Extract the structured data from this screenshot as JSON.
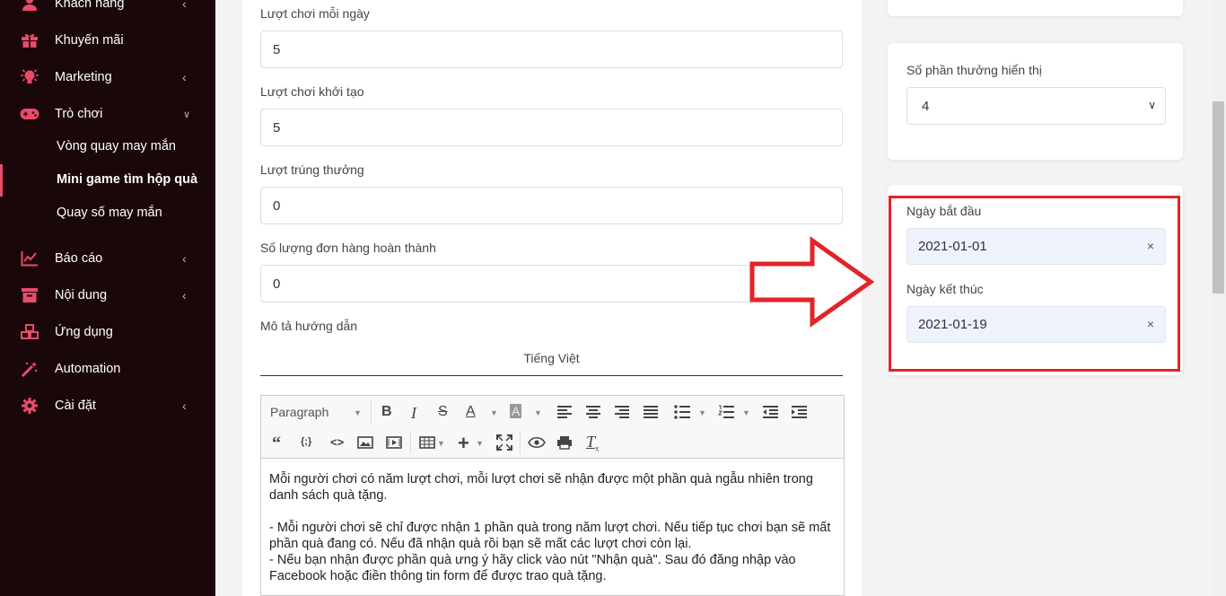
{
  "sidebar": {
    "items": [
      {
        "label": "Khách hàng",
        "icon": "user-icon"
      },
      {
        "label": "Khuyến mãi",
        "icon": "gift-icon"
      },
      {
        "label": "Marketing",
        "icon": "lightbulb-icon"
      },
      {
        "label": "Trò chơi",
        "icon": "gamepad-icon"
      },
      {
        "label": "Báo cáo",
        "icon": "chart-icon"
      },
      {
        "label": "Nội dung",
        "icon": "archive-icon"
      },
      {
        "label": "Ứng dụng",
        "icon": "cubes-icon"
      },
      {
        "label": "Automation",
        "icon": "magic-wand-icon"
      },
      {
        "label": "Cài đặt",
        "icon": "gear-icon"
      }
    ],
    "subitems": [
      {
        "label": "Vòng quay may mắn"
      },
      {
        "label": "Mini game tìm hộp quà"
      },
      {
        "label": "Quay số may mắn"
      }
    ]
  },
  "form": {
    "daily_plays_label": "Lượt chơi mỗi ngày",
    "daily_plays_value": "5",
    "initial_plays_label": "Lượt chơi khởi tạo",
    "initial_plays_value": "5",
    "wins_label": "Lượt trúng thưởng",
    "wins_value": "0",
    "orders_label": "Số lượng đơn hàng hoàn thành",
    "orders_value": "0",
    "description_label": "Mô tả hướng dẫn",
    "language_tab": "Tiếng Việt"
  },
  "editor": {
    "format_select": "Paragraph",
    "content": "Mỗi người chơi có năm lượt chơi, mỗi lượt chơi sẽ nhận được một phần quà ngẫu nhiên trong danh sách quà tặng.\n\n- Mỗi người chơi sẽ chỉ được nhận 1 phần quà trong năm lượt chơi. Nếu tiếp tục chơi bạn sẽ mất phần quà đang có. Nếu đã nhận quà rồi bạn sẽ mất các lượt chơi còn lại.\n- Nếu bạn nhận được phần quà ưng ý hãy click vào nút \"Nhận quà\". Sau đó đăng nhập vào Facebook hoặc điền thông tin form để được trao quà tặng."
  },
  "right": {
    "rewards_label": "Số phần thưởng hiển thị",
    "rewards_value": "4",
    "start_label": "Ngày bắt đầu",
    "start_value": "2021-01-01",
    "end_label": "Ngày kết thúc",
    "end_value": "2021-01-19",
    "clear_glyph": "×"
  },
  "colors": {
    "sidebar_bg": "#1a0709",
    "accent": "#e94b6b",
    "annotation_red": "#e32329"
  }
}
